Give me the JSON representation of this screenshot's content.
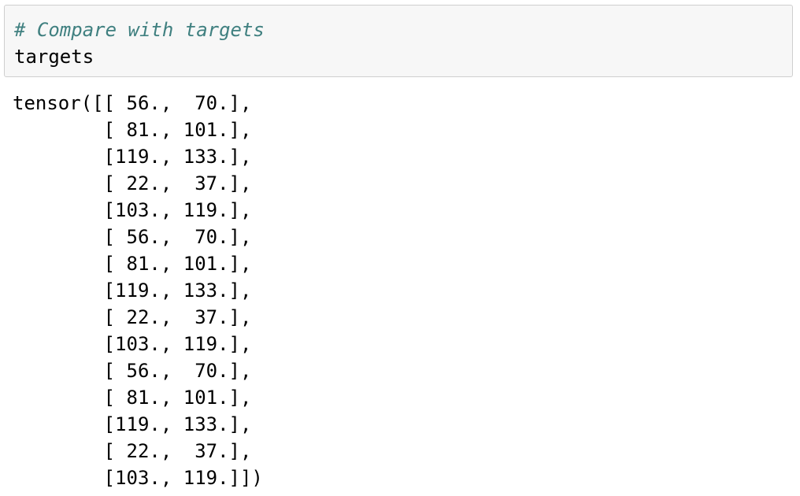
{
  "input_cell": {
    "comment": "# Compare with targets",
    "code": "targets"
  },
  "output": {
    "lines": [
      "tensor([[ 56.,  70.],",
      "        [ 81., 101.],",
      "        [119., 133.],",
      "        [ 22.,  37.],",
      "        [103., 119.],",
      "        [ 56.,  70.],",
      "        [ 81., 101.],",
      "        [119., 133.],",
      "        [ 22.,  37.],",
      "        [103., 119.],",
      "        [ 56.,  70.],",
      "        [ 81., 101.],",
      "        [119., 133.],",
      "        [ 22.,  37.],",
      "        [103., 119.]])"
    ]
  }
}
